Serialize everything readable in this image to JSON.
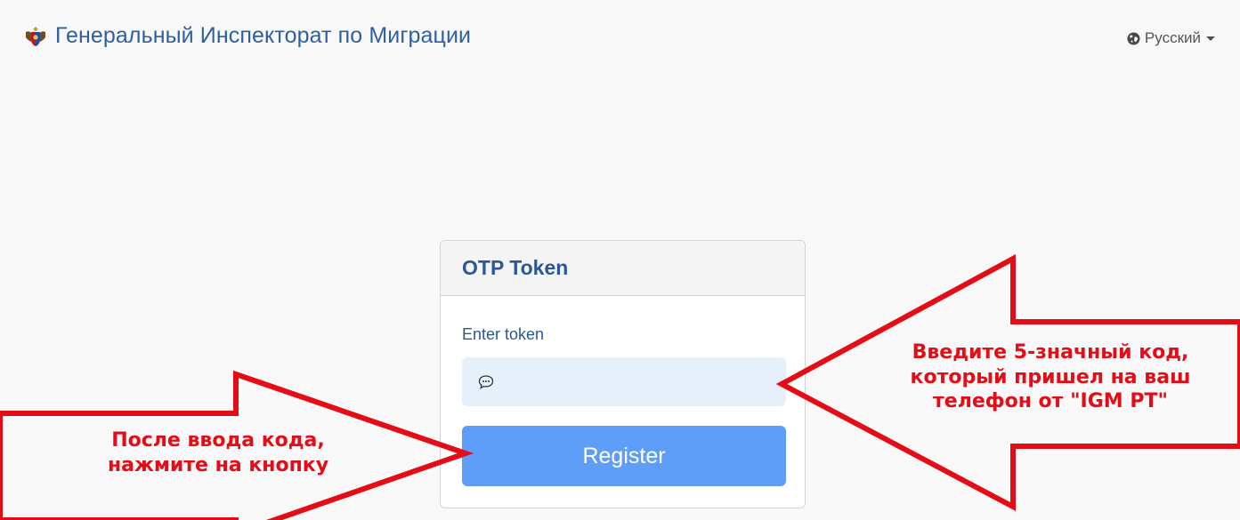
{
  "header": {
    "brand_title": "Генеральный Инспекторат по Миграции",
    "brand_logo_icon": "coat-of-arms-icon",
    "language": {
      "icon": "globe-icon",
      "selected": "Русский"
    }
  },
  "otp_card": {
    "title": "OTP Token",
    "field_label": "Enter token",
    "input_icon": "chat-bubble-icon",
    "input_value": "",
    "submit_label": "Register"
  },
  "annotations": {
    "right_text": "Введите 5-значный код,\nкоторый пришел на ваш\nтелефон от \"IGM PT\"",
    "left_text": "После ввода кода,\nнажмите на кнопку"
  },
  "colors": {
    "brand": "#2f5fa0",
    "button": "#5f9ef8",
    "input_bg": "#e5f0fb",
    "annotation_red": "#e30c17",
    "page_bg": "#f8f8f8"
  }
}
